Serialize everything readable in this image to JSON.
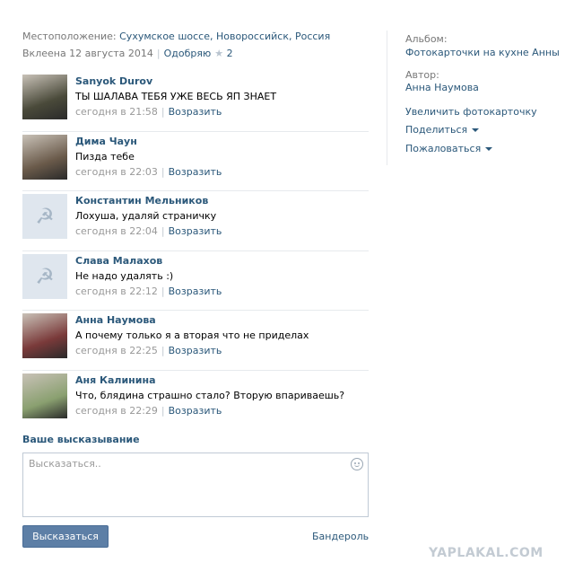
{
  "photo": {
    "location_label": "Местоположение:",
    "location_value": "Сухумское шоссе, Новороссийск, Россия",
    "posted": "Вклеена 12 августа 2014",
    "like_label": "Одобряю",
    "like_count": "2"
  },
  "comments": [
    {
      "author": "Sanyok Durov",
      "text": "ТЫ ШАЛАВА ТЕБЯ УЖЕ ВЕСЬ ЯП ЗНАЕТ",
      "time": "сегодня в 21:58",
      "reply": "Возразить",
      "avatar": "photo",
      "avatar_color": "#4a4a3a"
    },
    {
      "author": "Дима Чаун",
      "text": "Пизда тебе",
      "time": "сегодня в 22:03",
      "reply": "Возразить",
      "avatar": "photo",
      "avatar_color": "#6a5a4a"
    },
    {
      "author": "Константин Мельников",
      "text": "Лохуша, удаляй страничку",
      "time": "сегодня в 22:04",
      "reply": "Возразить",
      "avatar": "hammer-sickle-icon",
      "avatar_color": "#dfe6ee"
    },
    {
      "author": "Слава Малахов",
      "text": "Не надо удалять :)",
      "time": "сегодня в 22:12",
      "reply": "Возразить",
      "avatar": "hammer-sickle-icon",
      "avatar_color": "#dfe6ee"
    },
    {
      "author": "Анна Наумова",
      "text": "А почему только я а вторая что не приделах",
      "time": "сегодня в 22:25",
      "reply": "Возразить",
      "avatar": "photo",
      "avatar_color": "#7a3a3a"
    },
    {
      "author": "Аня Калинина",
      "text": "Что, блядина страшно стало? Вторую впариваешь?",
      "time": "сегодня в 22:29",
      "reply": "Возразить",
      "avatar": "photo",
      "avatar_color": "#8aa070"
    }
  ],
  "reply_form": {
    "title": "Ваше высказывание",
    "placeholder": "Высказаться..",
    "submit": "Высказаться",
    "banderol": "Бандероль"
  },
  "sidebar": {
    "album_label": "Альбом:",
    "album_value": "Фотокарточки на кухне Анны",
    "author_label": "Автор:",
    "author_value": "Анна Наумова",
    "enlarge": "Увеличить фотокарточку",
    "share": "Поделиться",
    "report": "Пожаловаться"
  },
  "watermark": "YAPLAKAL.COM",
  "colors": {
    "link": "#2b587a",
    "button": "#5d7fa6",
    "divider": "#e7eaed"
  }
}
